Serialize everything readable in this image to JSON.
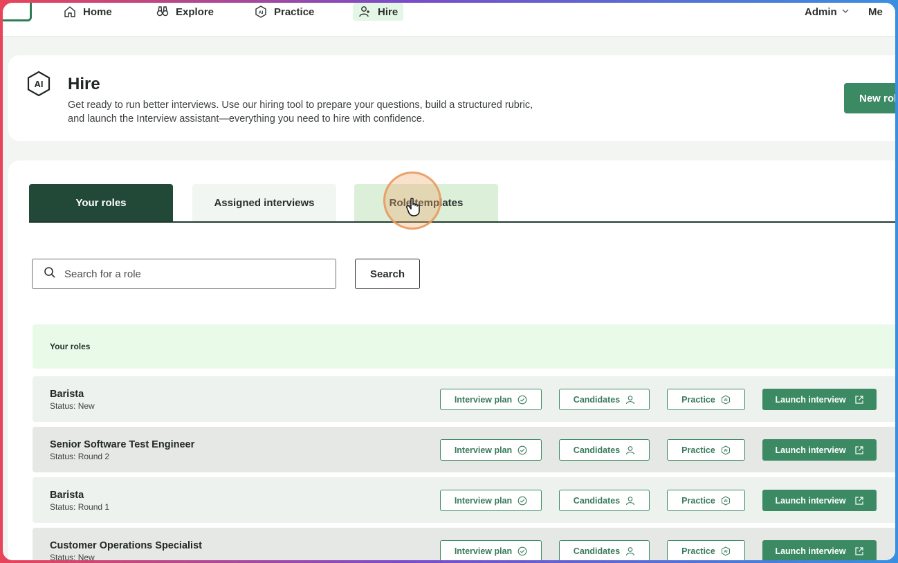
{
  "nav": {
    "items": [
      {
        "label": "Home",
        "icon": "home-icon"
      },
      {
        "label": "Explore",
        "icon": "binoculars-icon"
      },
      {
        "label": "Practice",
        "icon": "ai-hexagon-icon"
      },
      {
        "label": "Hire",
        "icon": "add-person-icon"
      }
    ],
    "admin_label": "Admin",
    "me_label": "Me"
  },
  "hero": {
    "title": "Hire",
    "description": "Get ready to run better interviews. Use our hiring tool to prepare your questions, build a structured rubric, and launch the Interview assistant—everything you need to hire with confidence.",
    "new_role_label": "New rol"
  },
  "tabs": [
    {
      "label": "Your roles"
    },
    {
      "label": "Assigned interviews"
    },
    {
      "label": "Role templates"
    }
  ],
  "search": {
    "placeholder": "Search for a role",
    "button_label": "Search"
  },
  "roles_section": {
    "header": "Your roles",
    "buttons": {
      "interview_plan": "Interview plan",
      "candidates": "Candidates",
      "practice": "Practice",
      "launch": "Launch interview"
    },
    "rows": [
      {
        "name": "Barista",
        "status": "Status: New"
      },
      {
        "name": "Senior Software Test Engineer",
        "status": "Status: Round 2"
      },
      {
        "name": "Barista",
        "status": "Status: Round 1"
      },
      {
        "name": "Customer Operations Specialist",
        "status": "Status: New"
      }
    ]
  },
  "colors": {
    "brand_green": "#3b8a63",
    "dark_tab": "#224838",
    "section_header_bg": "#e9fbe8"
  }
}
